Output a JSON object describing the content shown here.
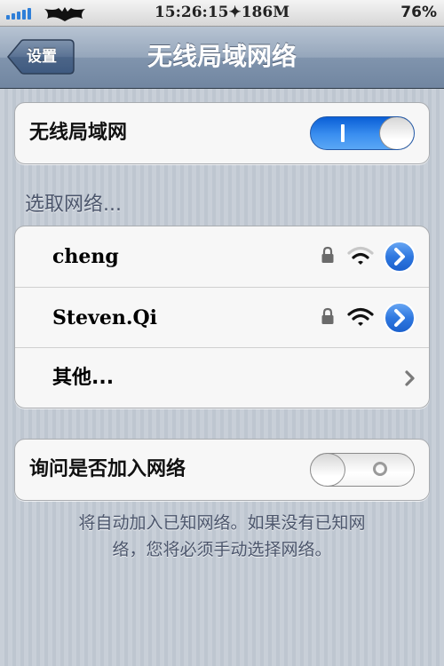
{
  "status_bar": {
    "time_carrier": "15:26:15✦186M",
    "battery": "76%",
    "signal_bars": 5,
    "carrier_logo": "bat-icon"
  },
  "nav": {
    "back_label": "设置",
    "title": "无线局域网络"
  },
  "wifi_toggle_row": {
    "label": "无线局域网",
    "enabled": true
  },
  "networks_section": {
    "header": "选取网络...",
    "networks": [
      {
        "name": "cheng",
        "secured": true,
        "signal": "weak",
        "accessory": "detail-disclosure-icon"
      },
      {
        "name": "Steven.Qi",
        "secured": true,
        "signal": "strong",
        "accessory": "detail-disclosure-icon"
      }
    ],
    "other_label": "其他...",
    "other_accessory": "chevron-right-icon"
  },
  "ask_join_row": {
    "label": "询问是否加入网络",
    "enabled": false
  },
  "footer": {
    "line1": "将自动加入已知网络。如果没有已知网",
    "line2": "络，您将必须手动选择网络。"
  },
  "colors": {
    "toggle_on": "#2f86ec",
    "detail_button": "#2d72d9",
    "nav_bar": "#8b9db3",
    "section_text": "#4c566c"
  }
}
